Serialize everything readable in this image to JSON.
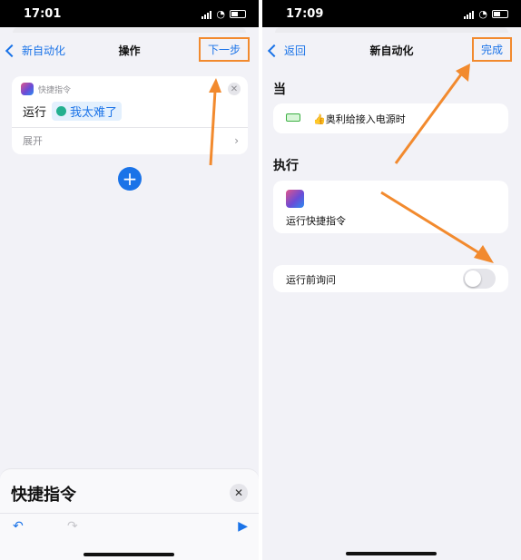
{
  "accent_color": "#1a73e8",
  "highlight_color": "#f28a2e",
  "left": {
    "time": "17:01",
    "nav": {
      "back": "新自动化",
      "title": "操作",
      "action": "下一步"
    },
    "action_card": {
      "app_name": "快捷指令",
      "verb": "运行",
      "shortcut": "我太难了",
      "expand": "展开"
    },
    "sheet": {
      "title": "快捷指令"
    }
  },
  "right": {
    "time": "17:09",
    "nav": {
      "back": "返回",
      "title": "新自动化",
      "action": "完成"
    },
    "when_header": "当",
    "trigger": "👍奥利给接入电源时",
    "do_header": "执行",
    "run_action": "运行快捷指令",
    "ask_label": "运行前询问",
    "ask_before_running": false
  }
}
